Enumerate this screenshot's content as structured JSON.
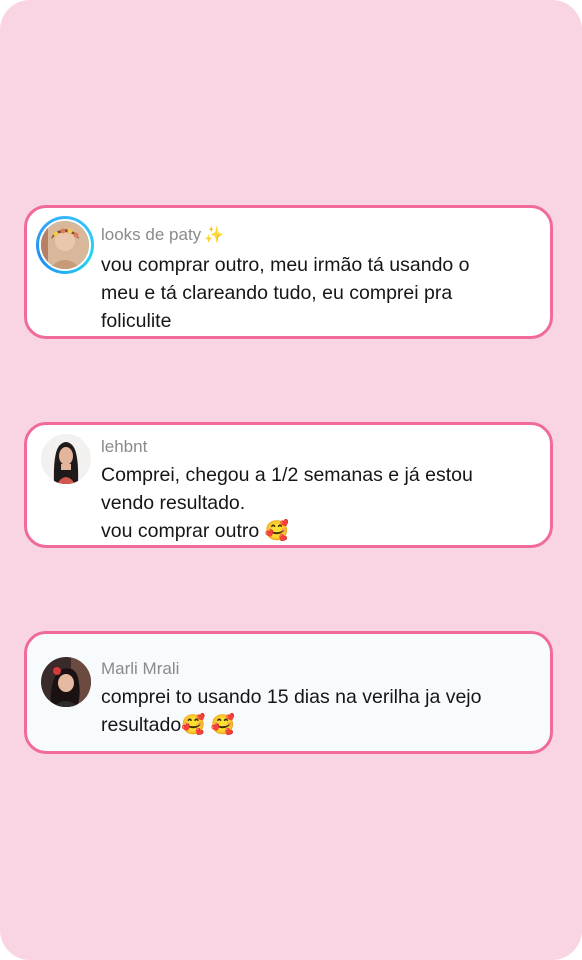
{
  "colors": {
    "background": "#f9d4e3",
    "card_border": "#f06a9c",
    "card_fill": "#ffffff",
    "username": "#8a8a8a",
    "comment_text": "#161616"
  },
  "comments": [
    {
      "username": "looks de paty",
      "username_suffix": "✨",
      "avatar": "profile-photo-with-story-ring",
      "lines": [
        "vou comprar outro, meu irmão tá usando o",
        "meu e tá clareando tudo, eu comprei pra",
        "foliculite"
      ]
    },
    {
      "username": "lehbnt",
      "avatar": "profile-photo",
      "lines": [
        "Comprei, chegou a 1/2 semanas e já estou",
        "vendo resultado.",
        "vou comprar outro 🥰"
      ]
    },
    {
      "username": "Marli Mrali",
      "avatar": "profile-photo",
      "lines": [
        "comprei to usando 15 dias na verilha ja vejo",
        "resultado🥰 🥰"
      ]
    }
  ]
}
